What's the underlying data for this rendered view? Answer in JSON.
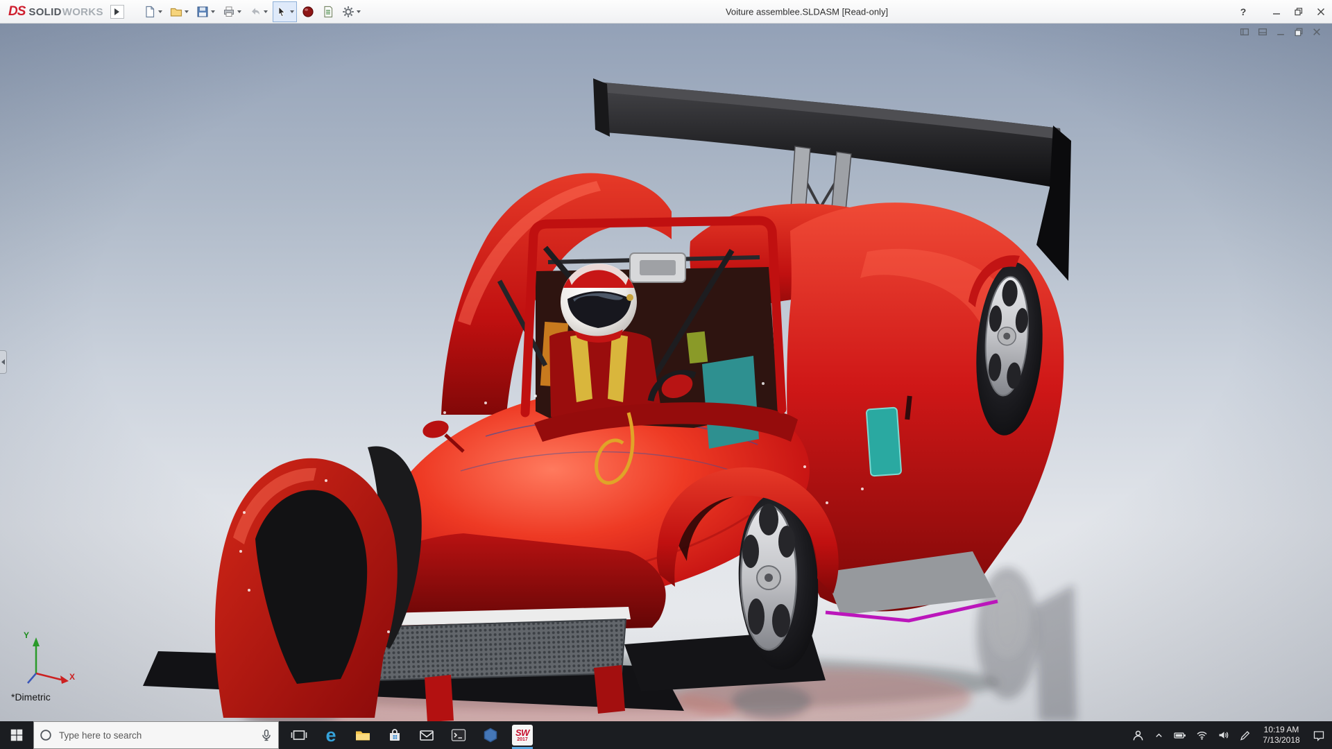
{
  "titlebar": {
    "brand": {
      "ds": "DS",
      "solid": "SOLID",
      "works": "WORKS"
    },
    "title": "Voiture assemblee.SLDASM [Read-only]",
    "help_label": "?"
  },
  "toolbar": {
    "icons": [
      "new-document",
      "open",
      "save",
      "print",
      "undo",
      "select",
      "rebuild",
      "file-properties",
      "options"
    ]
  },
  "viewport": {
    "view_orientation": "*Dimetric",
    "triad": {
      "x_label": "X",
      "y_label": "Y"
    }
  },
  "taskbar": {
    "search_placeholder": "Type here to search",
    "edge_glyph": "e",
    "solidworks_badge": {
      "top": "SW",
      "year": "2017"
    },
    "clock": {
      "time": "10:19 AM",
      "date": "7/13/2018"
    }
  }
}
